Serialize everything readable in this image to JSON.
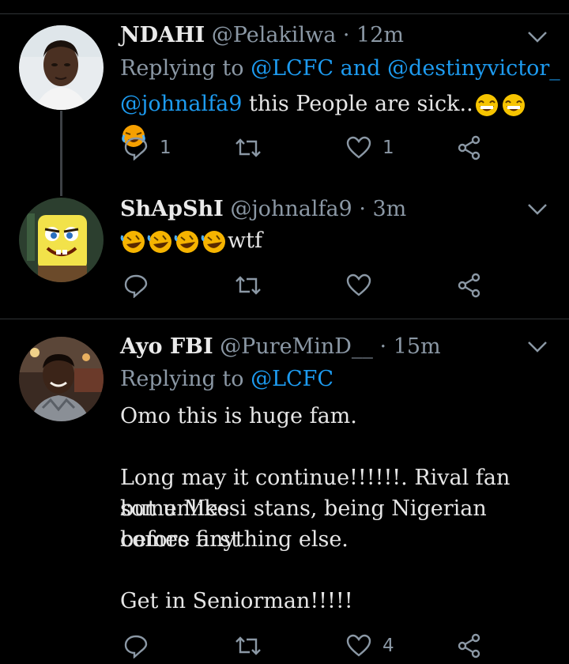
{
  "tweets": [
    {
      "name": "ƝDAHI",
      "handle": "@Pelakilwa",
      "time": "· 12m",
      "replying_prefix": "Replying to",
      "replying_to": [
        "@LCFC",
        "@destinyvictor_"
      ],
      "replying_joiner": "and",
      "body_mention": "@johnalfa9",
      "body_text": "this People are sick..",
      "counts": {
        "reply": "1",
        "retweet": "",
        "like": "1"
      }
    },
    {
      "name": "ShApShI",
      "handle": "@johnalfa9",
      "time": "· 3m",
      "body_text": "wtf",
      "counts": {
        "reply": "",
        "retweet": "",
        "like": ""
      }
    },
    {
      "name": "Ayo FBI",
      "handle": "@PureMinD__",
      "time": "· 15m",
      "replying_prefix": "Replying to",
      "replying_to": [
        "@LCFC"
      ],
      "lines": [
        "Omo this is huge fam.",
        "",
        "Long may it continue!!!!!!. Rival fan but unlike",
        "some Messi stans, being Nigerian comes first",
        "before anything else.",
        "",
        "Get in Seniorman!!!!!"
      ],
      "counts": {
        "reply": "",
        "retweet": "",
        "like": "4"
      }
    }
  ],
  "colors": {
    "accent": "#1d9bf0",
    "muted": "#8b98a5",
    "background": "#000000"
  },
  "icons": [
    "reply-icon",
    "retweet-icon",
    "like-icon",
    "share-icon",
    "chevron-down-icon"
  ]
}
